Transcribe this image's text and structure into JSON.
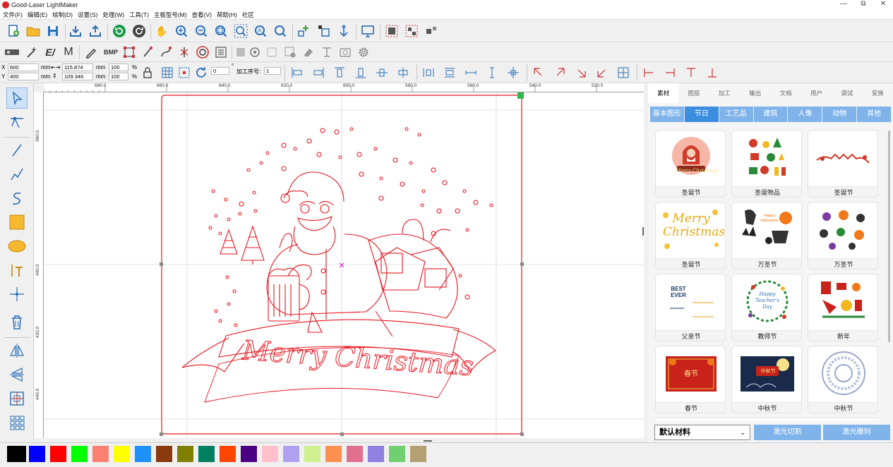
{
  "window": {
    "title": "Good-Laser LightMaker",
    "controls": [
      "—",
      "⧉",
      "✕"
    ]
  },
  "menu": [
    "文件(F)",
    "编辑(E)",
    "绘制(D)",
    "设置(S)",
    "处理(W)",
    "工具(T)",
    "主板型号(M)",
    "查看(V)",
    "帮助(H)",
    "社区"
  ],
  "toolbar2": {
    "bmp_label": "BMP",
    "m_label": "M"
  },
  "position": {
    "x_label": "X",
    "y_label": "Y",
    "x": "600",
    "y": "400",
    "unit": "mm",
    "width": "115.874",
    "height": "109.346",
    "w_unit": "mm",
    "h_unit": "mm",
    "w_pct": "100",
    "h_pct": "100",
    "pct": "%",
    "angle": "0",
    "angle_unit": "°",
    "order_label": "加工序号:",
    "order": "1"
  },
  "ruler": {
    "top": [
      "680.0",
      "660.0",
      "640.0",
      "620.0",
      "600.0",
      "580.0",
      "560.0",
      "540.0",
      "520.0"
    ],
    "left": [
      "380.0",
      "400.0",
      "420.0",
      "440.0"
    ]
  },
  "canvas": {
    "text": "Merry Christmas",
    "accent": "#e8141e"
  },
  "panel": {
    "tabs": [
      "素材",
      "图层",
      "加工",
      "输出",
      "文档",
      "用户",
      "调试",
      "变换"
    ],
    "categories": [
      "基本图形",
      "节日",
      "工艺品",
      "建筑",
      "人像",
      "动物",
      "其他"
    ],
    "cards": [
      {
        "label": "圣诞节",
        "art": "Merry Christmas"
      },
      {
        "label": "圣诞物品",
        "art": ""
      },
      {
        "label": "圣诞节",
        "art": ""
      },
      {
        "label": "圣诞节",
        "art": "Merry Christmas"
      },
      {
        "label": "万圣节",
        "art": "Happy Halloween"
      },
      {
        "label": "万圣节",
        "art": ""
      },
      {
        "label": "父亲节",
        "art": "BEST EVER"
      },
      {
        "label": "教师节",
        "art": "Happy Teacher's Day"
      },
      {
        "label": "新年",
        "art": ""
      },
      {
        "label": "春节",
        "art": "春节"
      },
      {
        "label": "中秋节",
        "art": "中秋节"
      },
      {
        "label": "中秋节",
        "art": ""
      }
    ],
    "material": "默认材料",
    "cut_button": "激光切割",
    "engrave_button": "激光雕刻"
  },
  "palette": [
    "#000000",
    "#0000ff",
    "#ff0000",
    "#00ff00",
    "#fa8072",
    "#ffff00",
    "#1e90ff",
    "#8b3a0f",
    "#808000",
    "#008060",
    "#ff4500",
    "#4b0082",
    "#ffc0cb",
    "#b0a0f0",
    "#d0f090",
    "#ff9050",
    "#e07090",
    "#9080e0",
    "#70d070",
    "#b4a070"
  ]
}
